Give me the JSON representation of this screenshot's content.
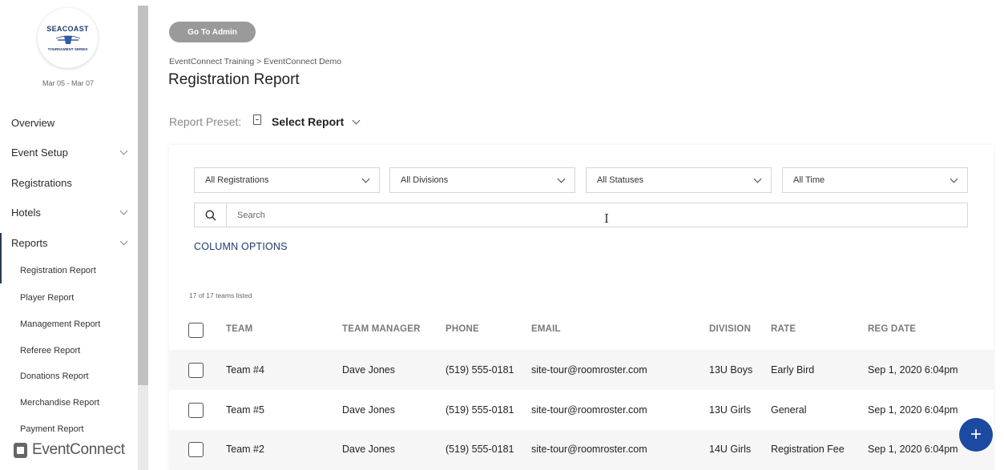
{
  "sidebar": {
    "logo": {
      "top": "SEACOAST",
      "bottom": "TOURNAMENT SERIES"
    },
    "dates": "Mar 05 - Mar 07",
    "nav": [
      {
        "label": "Overview",
        "expandable": false
      },
      {
        "label": "Event Setup",
        "expandable": true
      },
      {
        "label": "Registrations",
        "expandable": false
      },
      {
        "label": "Hotels",
        "expandable": true
      },
      {
        "label": "Reports",
        "expandable": true,
        "active": true
      }
    ],
    "sub_items": [
      "Registration Report",
      "Player Report",
      "Management Report",
      "Referee Report",
      "Donations Report",
      "Merchandise Report",
      "Payment Report"
    ],
    "brand": "EventConnect"
  },
  "header": {
    "go_admin": "Go To Admin",
    "breadcrumb": [
      "EventConnect Training",
      "EventConnect Demo"
    ],
    "breadcrumb_sep": ">",
    "title": "Registration Report"
  },
  "preset": {
    "label": "Report Preset:",
    "value": "Select Report"
  },
  "filters": [
    "All Registrations",
    "All Divisions",
    "All Statuses",
    "All Time"
  ],
  "search": {
    "placeholder": "Search"
  },
  "column_options": "COLUMN OPTIONS",
  "count_text": "17 of 17 teams listed",
  "table": {
    "columns": [
      "TEAM",
      "TEAM MANAGER",
      "PHONE",
      "EMAIL",
      "DIVISION",
      "RATE",
      "REG DATE"
    ],
    "rows": [
      [
        "Team #4",
        "Dave Jones",
        "(519) 555-0181",
        "site-tour@roomroster.com",
        "13U Boys",
        "Early Bird",
        "Sep 1, 2020 6:04pm"
      ],
      [
        "Team #5",
        "Dave Jones",
        "(519) 555-0181",
        "site-tour@roomroster.com",
        "13U Girls",
        "General",
        "Sep 1, 2020 6:04pm"
      ],
      [
        "Team #2",
        "Dave Jones",
        "(519) 555-0181",
        "site-tour@roomroster.com",
        "14U Girls",
        "Registration Fee",
        "Sep 1, 2020 6:04pm"
      ]
    ]
  },
  "fab": {
    "icon": "plus-icon",
    "label": "+"
  },
  "colors": {
    "accent": "#1c4aa0",
    "link": "#1d3a6e",
    "button_gray": "#9a9a9a"
  }
}
